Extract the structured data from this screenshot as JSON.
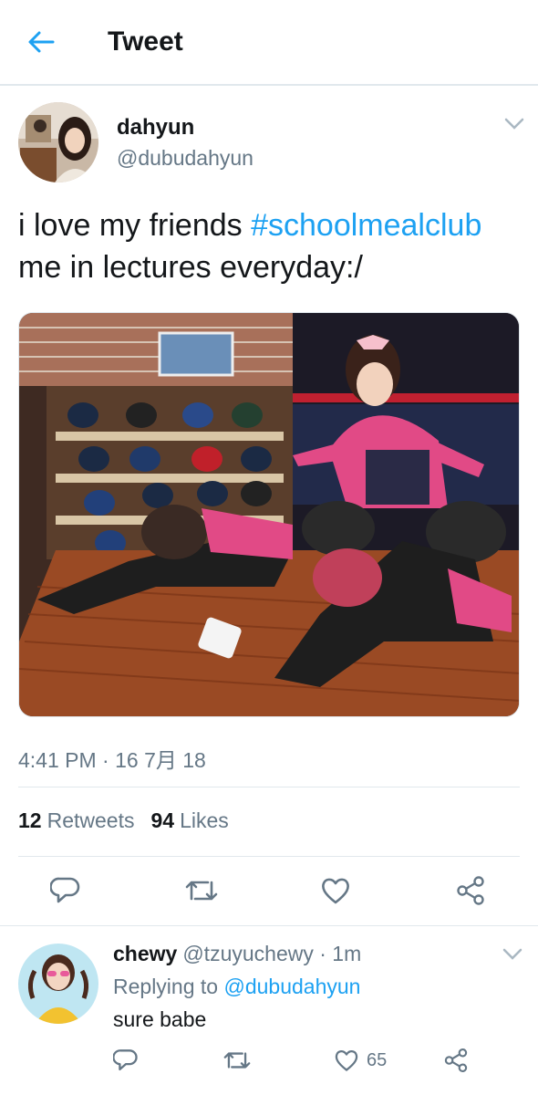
{
  "header": {
    "title": "Tweet"
  },
  "tweet": {
    "author_name": "dahyun",
    "author_handle": "@dubudahyun",
    "text_line1": "i love my friends ",
    "hashtag": "#schoolmealclub",
    "text_line2": "me in lectures everyday:/",
    "timestamp": "4:41 PM · 16 7月 18",
    "retweets": "12",
    "retweets_label": "Retweets",
    "likes": "94",
    "likes_label": "Likes",
    "actions": [
      "reply-icon",
      "retweet-icon",
      "like-icon",
      "share-icon"
    ]
  },
  "reply": {
    "author_name": "chewy",
    "meta": "@tzuyuchewy · 1m",
    "replying_prefix": "Replying to ",
    "replying_to": "@dubudahyun",
    "text": "sure babe",
    "like_count": "65"
  },
  "colors": {
    "accent": "#1da1f2",
    "secondary_text": "#657786",
    "border": "#e1e8ed"
  }
}
